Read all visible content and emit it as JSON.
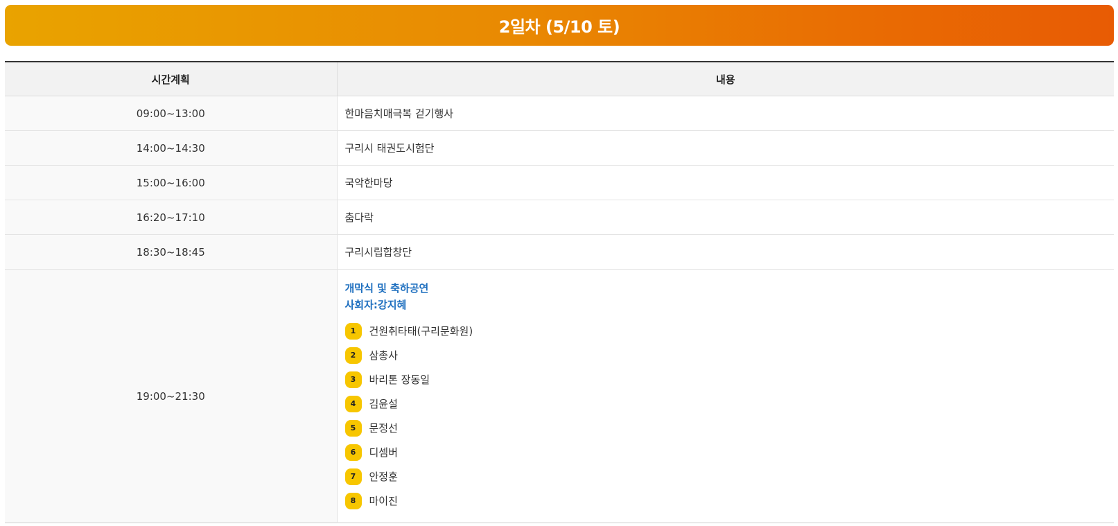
{
  "day_title": "2일차 (5/10 토)",
  "table": {
    "headers": {
      "time": "시간계획",
      "content": "내용"
    },
    "rows": [
      {
        "time": "09:00~13:00",
        "content": "한마음치매극복 걷기행사"
      },
      {
        "time": "14:00~14:30",
        "content": "구리시 태권도시험단"
      },
      {
        "time": "15:00~16:00",
        "content": "국악한마당"
      },
      {
        "time": "16:20~17:10",
        "content": "춤다락"
      },
      {
        "time": "18:30~18:45",
        "content": "구리시립합창단"
      }
    ],
    "main_event": {
      "time": "19:00~21:30",
      "title": "개막식 및 축하공연",
      "host": "사회자:강지혜",
      "performers": [
        {
          "num": "1",
          "name": "건원취타태(구리문화원)"
        },
        {
          "num": "2",
          "name": "삼총사"
        },
        {
          "num": "3",
          "name": "바리톤 장동일"
        },
        {
          "num": "4",
          "name": "김윤설"
        },
        {
          "num": "5",
          "name": "문정선"
        },
        {
          "num": "6",
          "name": "디셈버"
        },
        {
          "num": "7",
          "name": "안정훈"
        },
        {
          "num": "8",
          "name": "마이진"
        }
      ]
    }
  },
  "colors": {
    "banner_start": "#e9a300",
    "banner_end": "#e85b04",
    "event_title": "#1e6fbf",
    "badge": "#f7c600"
  }
}
